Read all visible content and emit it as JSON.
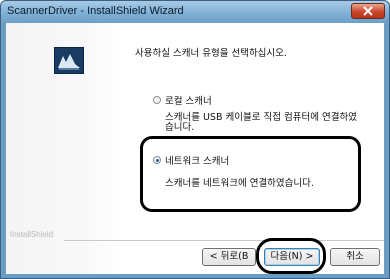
{
  "window": {
    "title": "ScannerDriver - InstallShield Wizard",
    "brand_text": "InstallShield"
  },
  "main": {
    "instruction": "사용하실 스캐너 유형을 선택하십시오.",
    "options": [
      {
        "label": "로컬 스캐너",
        "description": "스캐너를 USB 케이블로 직접 컴퓨터에 연결하였습니다.",
        "selected": false
      },
      {
        "label": "네트워크 스캐너",
        "description": "스캐너를 네트워크에 연결하였습니다.",
        "selected": true
      }
    ]
  },
  "buttons": {
    "back": "< 뒤로(B",
    "next": "다음(N) >",
    "cancel": "취소"
  },
  "colors": {
    "titlebar": "#7fb0d6",
    "close": "#c9482b",
    "logo": "#1a3c63"
  }
}
